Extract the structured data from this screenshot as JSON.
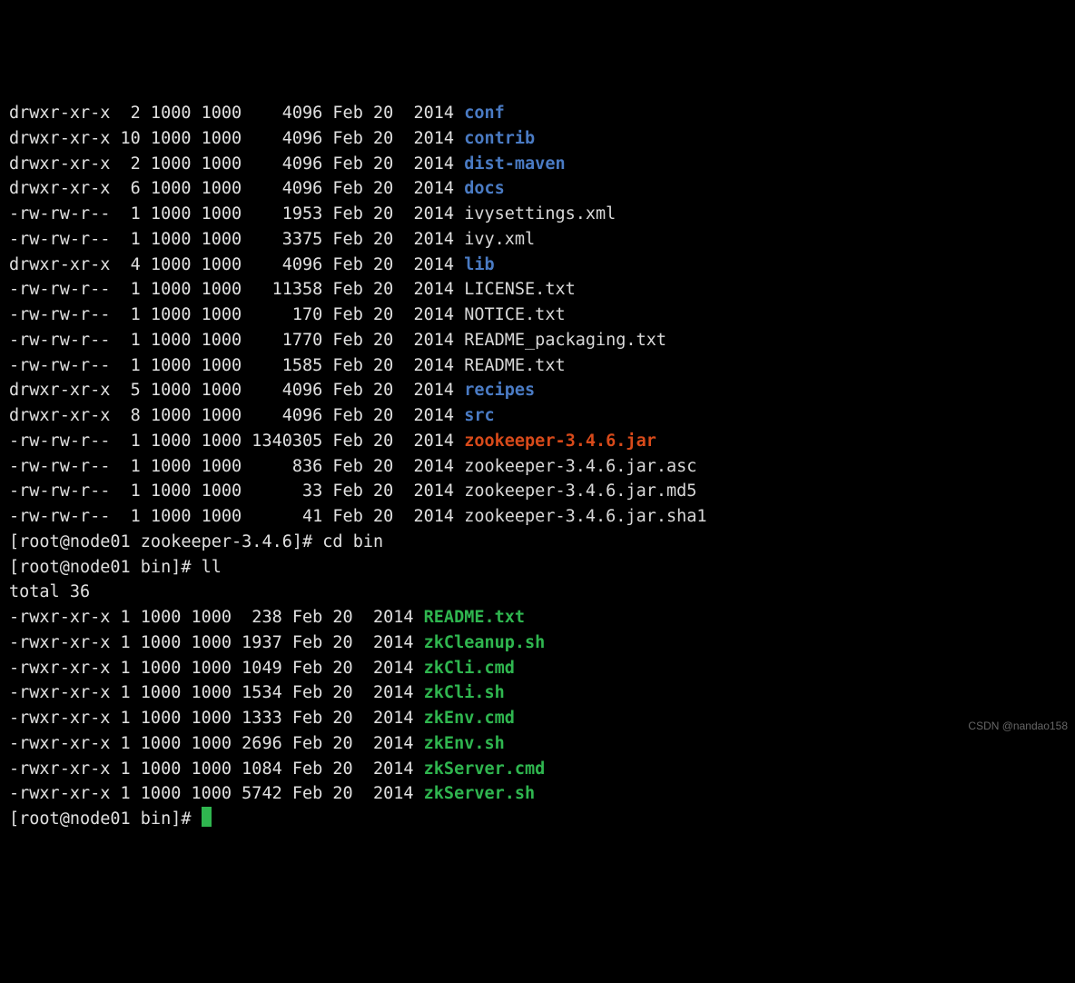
{
  "listing_top": [
    {
      "perm": "drwxr-xr-x",
      "links": "2",
      "uid": "1000",
      "gid": "1000",
      "size": "4096",
      "size_pad": 7,
      "mon": "Feb",
      "day": "20",
      "year": "2014",
      "name": "conf",
      "cls": "fn-dir"
    },
    {
      "perm": "drwxr-xr-x",
      "links": "10",
      "uid": "1000",
      "gid": "1000",
      "size": "4096",
      "size_pad": 7,
      "mon": "Feb",
      "day": "20",
      "year": "2014",
      "name": "contrib",
      "cls": "fn-dir"
    },
    {
      "perm": "drwxr-xr-x",
      "links": "2",
      "uid": "1000",
      "gid": "1000",
      "size": "4096",
      "size_pad": 7,
      "mon": "Feb",
      "day": "20",
      "year": "2014",
      "name": "dist-maven",
      "cls": "fn-dir"
    },
    {
      "perm": "drwxr-xr-x",
      "links": "6",
      "uid": "1000",
      "gid": "1000",
      "size": "4096",
      "size_pad": 7,
      "mon": "Feb",
      "day": "20",
      "year": "2014",
      "name": "docs",
      "cls": "fn-dir"
    },
    {
      "perm": "-rw-rw-r--",
      "links": "1",
      "uid": "1000",
      "gid": "1000",
      "size": "1953",
      "size_pad": 7,
      "mon": "Feb",
      "day": "20",
      "year": "2014",
      "name": "ivysettings.xml",
      "cls": "fn-file"
    },
    {
      "perm": "-rw-rw-r--",
      "links": "1",
      "uid": "1000",
      "gid": "1000",
      "size": "3375",
      "size_pad": 7,
      "mon": "Feb",
      "day": "20",
      "year": "2014",
      "name": "ivy.xml",
      "cls": "fn-file"
    },
    {
      "perm": "drwxr-xr-x",
      "links": "4",
      "uid": "1000",
      "gid": "1000",
      "size": "4096",
      "size_pad": 7,
      "mon": "Feb",
      "day": "20",
      "year": "2014",
      "name": "lib",
      "cls": "fn-dir"
    },
    {
      "perm": "-rw-rw-r--",
      "links": "1",
      "uid": "1000",
      "gid": "1000",
      "size": "11358",
      "size_pad": 7,
      "mon": "Feb",
      "day": "20",
      "year": "2014",
      "name": "LICENSE.txt",
      "cls": "fn-file"
    },
    {
      "perm": "-rw-rw-r--",
      "links": "1",
      "uid": "1000",
      "gid": "1000",
      "size": "170",
      "size_pad": 7,
      "mon": "Feb",
      "day": "20",
      "year": "2014",
      "name": "NOTICE.txt",
      "cls": "fn-file"
    },
    {
      "perm": "-rw-rw-r--",
      "links": "1",
      "uid": "1000",
      "gid": "1000",
      "size": "1770",
      "size_pad": 7,
      "mon": "Feb",
      "day": "20",
      "year": "2014",
      "name": "README_packaging.txt",
      "cls": "fn-file"
    },
    {
      "perm": "-rw-rw-r--",
      "links": "1",
      "uid": "1000",
      "gid": "1000",
      "size": "1585",
      "size_pad": 7,
      "mon": "Feb",
      "day": "20",
      "year": "2014",
      "name": "README.txt",
      "cls": "fn-file"
    },
    {
      "perm": "drwxr-xr-x",
      "links": "5",
      "uid": "1000",
      "gid": "1000",
      "size": "4096",
      "size_pad": 7,
      "mon": "Feb",
      "day": "20",
      "year": "2014",
      "name": "recipes",
      "cls": "fn-dir"
    },
    {
      "perm": "drwxr-xr-x",
      "links": "8",
      "uid": "1000",
      "gid": "1000",
      "size": "4096",
      "size_pad": 7,
      "mon": "Feb",
      "day": "20",
      "year": "2014",
      "name": "src",
      "cls": "fn-dir"
    },
    {
      "perm": "-rw-rw-r--",
      "links": "1",
      "uid": "1000",
      "gid": "1000",
      "size": "1340305",
      "size_pad": 7,
      "mon": "Feb",
      "day": "20",
      "year": "2014",
      "name": "zookeeper-3.4.6.jar",
      "cls": "fn-jar"
    },
    {
      "perm": "-rw-rw-r--",
      "links": "1",
      "uid": "1000",
      "gid": "1000",
      "size": "836",
      "size_pad": 7,
      "mon": "Feb",
      "day": "20",
      "year": "2014",
      "name": "zookeeper-3.4.6.jar.asc",
      "cls": "fn-file"
    },
    {
      "perm": "-rw-rw-r--",
      "links": "1",
      "uid": "1000",
      "gid": "1000",
      "size": "33",
      "size_pad": 7,
      "mon": "Feb",
      "day": "20",
      "year": "2014",
      "name": "zookeeper-3.4.6.jar.md5",
      "cls": "fn-file"
    },
    {
      "perm": "-rw-rw-r--",
      "links": "1",
      "uid": "1000",
      "gid": "1000",
      "size": "41",
      "size_pad": 7,
      "mon": "Feb",
      "day": "20",
      "year": "2014",
      "name": "zookeeper-3.4.6.jar.sha1",
      "cls": "fn-file"
    }
  ],
  "prompt1": {
    "text": "[root@node01 zookeeper-3.4.6]# ",
    "cmd": "cd bin"
  },
  "prompt2": {
    "text": "[root@node01 bin]# ",
    "cmd": "ll"
  },
  "total_line": "total 36",
  "listing_bin": [
    {
      "perm": "-rwxr-xr-x",
      "links": "1",
      "uid": "1000",
      "gid": "1000",
      "size": "238",
      "size_pad": 4,
      "mon": "Feb",
      "day": "20",
      "year": "2014",
      "name": "README.txt",
      "cls": "readme-hl"
    },
    {
      "perm": "-rwxr-xr-x",
      "links": "1",
      "uid": "1000",
      "gid": "1000",
      "size": "1937",
      "size_pad": 4,
      "mon": "Feb",
      "day": "20",
      "year": "2014",
      "name": "zkCleanup.sh",
      "cls": "fn-exec"
    },
    {
      "perm": "-rwxr-xr-x",
      "links": "1",
      "uid": "1000",
      "gid": "1000",
      "size": "1049",
      "size_pad": 4,
      "mon": "Feb",
      "day": "20",
      "year": "2014",
      "name": "zkCli.cmd",
      "cls": "fn-exec"
    },
    {
      "perm": "-rwxr-xr-x",
      "links": "1",
      "uid": "1000",
      "gid": "1000",
      "size": "1534",
      "size_pad": 4,
      "mon": "Feb",
      "day": "20",
      "year": "2014",
      "name": "zkCli.sh",
      "cls": "fn-exec"
    },
    {
      "perm": "-rwxr-xr-x",
      "links": "1",
      "uid": "1000",
      "gid": "1000",
      "size": "1333",
      "size_pad": 4,
      "mon": "Feb",
      "day": "20",
      "year": "2014",
      "name": "zkEnv.cmd",
      "cls": "fn-exec"
    },
    {
      "perm": "-rwxr-xr-x",
      "links": "1",
      "uid": "1000",
      "gid": "1000",
      "size": "2696",
      "size_pad": 4,
      "mon": "Feb",
      "day": "20",
      "year": "2014",
      "name": "zkEnv.sh",
      "cls": "fn-exec"
    },
    {
      "perm": "-rwxr-xr-x",
      "links": "1",
      "uid": "1000",
      "gid": "1000",
      "size": "1084",
      "size_pad": 4,
      "mon": "Feb",
      "day": "20",
      "year": "2014",
      "name": "zkServer.cmd",
      "cls": "fn-exec"
    },
    {
      "perm": "-rwxr-xr-x",
      "links": "1",
      "uid": "1000",
      "gid": "1000",
      "size": "5742",
      "size_pad": 4,
      "mon": "Feb",
      "day": "20",
      "year": "2014",
      "name": "zkServer.sh",
      "cls": "fn-exec"
    }
  ],
  "prompt3": {
    "text": "[root@node01 bin]# "
  },
  "watermark": "CSDN @nandao158"
}
